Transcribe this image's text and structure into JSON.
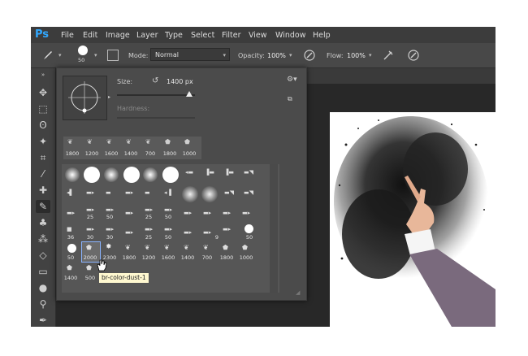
{
  "menubar": {
    "logo": "Ps",
    "items": [
      "File",
      "Edit",
      "Image",
      "Layer",
      "Type",
      "Select",
      "Filter",
      "View",
      "Window",
      "Help"
    ]
  },
  "options": {
    "brush_size": "50",
    "mode_label": "Mode:",
    "mode_value": "Normal",
    "opacity_label": "Opacity:",
    "opacity_value": "100%",
    "flow_label": "Flow:",
    "flow_value": "100%"
  },
  "brush_panel": {
    "size_label": "Size:",
    "size_value": "1400 px",
    "hardness_label": "Hardness:",
    "recent_sizes": [
      "1800",
      "1200",
      "1600",
      "1400",
      "700",
      "1800",
      "1000"
    ],
    "row3": [
      "",
      "25",
      "50",
      "",
      "25",
      "50",
      "",
      "",
      "",
      ""
    ],
    "row4": [
      "36",
      "30",
      "30",
      "",
      "25",
      "50",
      "",
      "",
      "9",
      "50"
    ],
    "row5": [
      "50",
      "2000",
      "2300",
      "1800",
      "1200",
      "1600",
      "1400",
      "700",
      "1800",
      "1000"
    ],
    "row6": [
      "1400",
      "500"
    ]
  },
  "tooltip": "br-color-dust-1",
  "colors": {
    "accent": "#31a8ff",
    "menubar_bg": "#3c3c3c",
    "panel_bg": "#4b4b4b",
    "canvas_bg": "#282828"
  }
}
